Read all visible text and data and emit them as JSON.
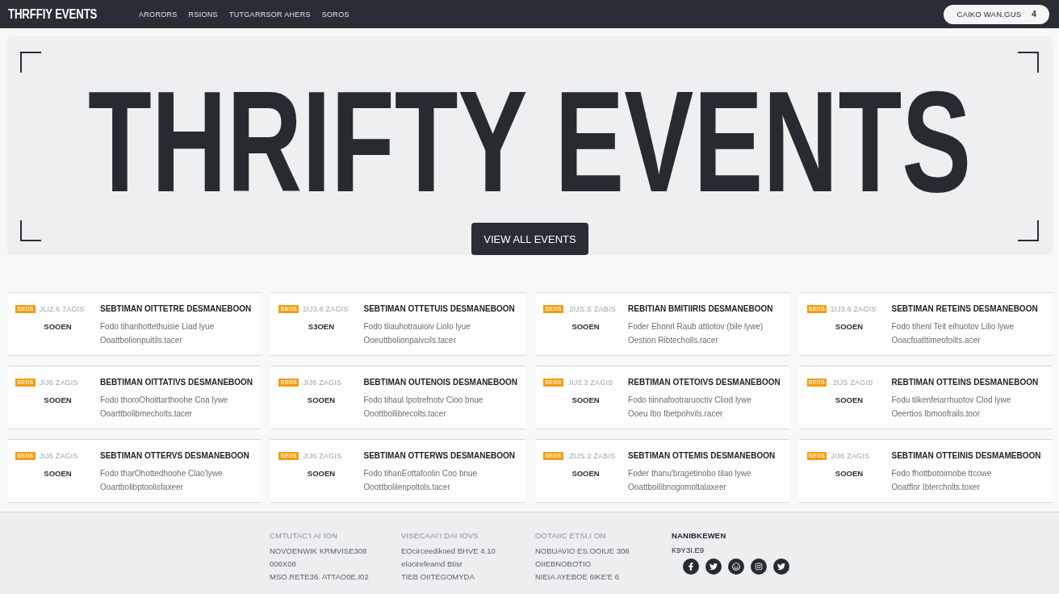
{
  "header": {
    "logo": "THRFFIY EVENTS",
    "nav": [
      {
        "label": "ARORORS"
      },
      {
        "label": "RSIONS"
      },
      {
        "label": "TUTGARRSOR AHERS"
      },
      {
        "label": "SOROS"
      }
    ],
    "account_button": {
      "label": "CAIKO WAN.GUS",
      "count": "4"
    }
  },
  "hero": {
    "title": "THRIFTY EVENTS",
    "button": "VIEW ALL EVENTS"
  },
  "events": [
    {
      "badge": "SEIIS",
      "date": "JLI2.6 7AGIS",
      "title": "SEBTIMAN OITTETRE DESMANEBOON",
      "time": "SOOEN",
      "description": [
        "Fodo tihanhottethuisie Liad lyue",
        "Ooattbolionpuitils.tacer"
      ]
    },
    {
      "badge": "SEIIS",
      "date": "2IJ3.6 ZAGIS",
      "title": "SEBTIMAN OTTETUIS DESMANEBOON",
      "time": "S3OEN",
      "description": [
        "Fodo tiiauhotrauioiv Liolo lyue",
        "Ooeuttbolionpaivcils.tacer"
      ]
    },
    {
      "badge": "SEIIS",
      "date": ".2IJS.S ZABIS",
      "title": "REBITIAN BMITIIRIS DESMANEBOON",
      "time": "SOOEN",
      "description": [
        "Foder Ehonrl Raub attiotov (bile lywe)",
        "Oestion Ribtecholls.racer"
      ]
    },
    {
      "badge": "SEIIS",
      "date": "2IJ3.6 ZAGIS",
      "title": "SEBTIMAN RETEINS DESMANEBOON",
      "time": "SOOEN",
      "description": [
        "Fodo tihenl Teit eihuotov Lilio lywe",
        "Ooacfoatltimeofoilts.acer"
      ]
    },
    {
      "badge": "SEIIS",
      "date": "JIJ6 ZAGIS",
      "title": "BEBTIMAN OITTATIVS DESMANEBOON",
      "time": "SOOEN",
      "description": [
        "Fodo thoroOhoittarthoohe Coa lywe",
        "Ooarttbolibmecholts.tacer"
      ]
    },
    {
      "badge": "SEIIS",
      "date": "JIJ6 ZAGIS",
      "title": "BEBTIMAN OUTENOIS DESMANEBOON",
      "time": "SOOEN",
      "description": [
        "Fodo tihaul Ipotrefnotv Cioo bnue",
        "Ooottbollibrecolts.tacer"
      ]
    },
    {
      "badge": "SEIIS",
      "date": ".IIJ3.3 ZAGIS",
      "title": "REBTIMAN OTETOIVS DESMANEBOON",
      "time": "SOOEN",
      "description": [
        "Fodo tiinnafootraruoctiv Cliod lywe",
        "Ooeu Ibo Ibetpohvils.racer"
      ]
    },
    {
      "badge": "SEIIS",
      "date": ".2IJS ZAGIS",
      "title": "REBTIMAN OTTEINS DESMANEBOON",
      "time": "SOOEN",
      "description": [
        "Fodu tilkenfeiarrhuotov Clod lywe",
        "Oeertios Ibmoofrails.toor"
      ]
    },
    {
      "badge": "SEIIS",
      "date": "JIJ6 ZAGIS",
      "title": "SEBTIMAN OTTERVS DESMANEBOON",
      "time": "SOOEN",
      "description": [
        "Fodo tharOhottedhoohe Clao'lywe",
        "Ooartbolibptoolisfaxeer"
      ]
    },
    {
      "badge": "SEIIS",
      "date": "JIJ6 ZAGIS",
      "title": "SEBTIMAN OTTERWS DESMANEBOON",
      "time": "SOOEN",
      "description": [
        "Fodo tihanEottafoolin Coo bnue",
        "Ooottbolilenpoltols.tacer"
      ]
    },
    {
      "badge": "SEIIS",
      "date": ".ZIJS.2 ZABIS",
      "title": "SEBTIMAN OTTEMIS DESMANEBOON",
      "time": "SOOEN",
      "description": [
        "Foder thanu'bragetinobo tilao lywe",
        "Ooattboilibnogomoltalaxeer"
      ]
    },
    {
      "badge": "SEIIS",
      "date": "JIJ6 ZAGIS",
      "title": "SEBTIMAN OTTEINIS DESMAMEBOON",
      "time": "SOOEN",
      "description": [
        "Fodo fhottbotoirnobe ttcowe",
        "Ooatflor Ibtercholts.toxer"
      ]
    }
  ],
  "footer": {
    "columns": [
      {
        "heading": "CMTUTAC'I AI ION",
        "lines": [
          "NOVOENWIK KRMVISE308",
          "006X08",
          "MSO.RETE36. ATTAO0E.I02"
        ]
      },
      {
        "heading": "VISECAAI'I DAI IOVS",
        "lines": [
          "EOcirceedikoed BHVE 4.10",
          "elocirefeamd Btisr",
          "TIEB OIITEGOMYDA"
        ]
      },
      {
        "heading": "OOTAIIC ETSI.I ON",
        "lines": [
          "NOBUAVIO ES.OOIUE 308",
          "OIIEBNOBOTIO",
          "NIEIA AYEBOE 6IKE'E 6"
        ]
      }
    ],
    "social": {
      "heading": "NANIBKEWEN",
      "handle": "K9Y3I.E9"
    }
  }
}
